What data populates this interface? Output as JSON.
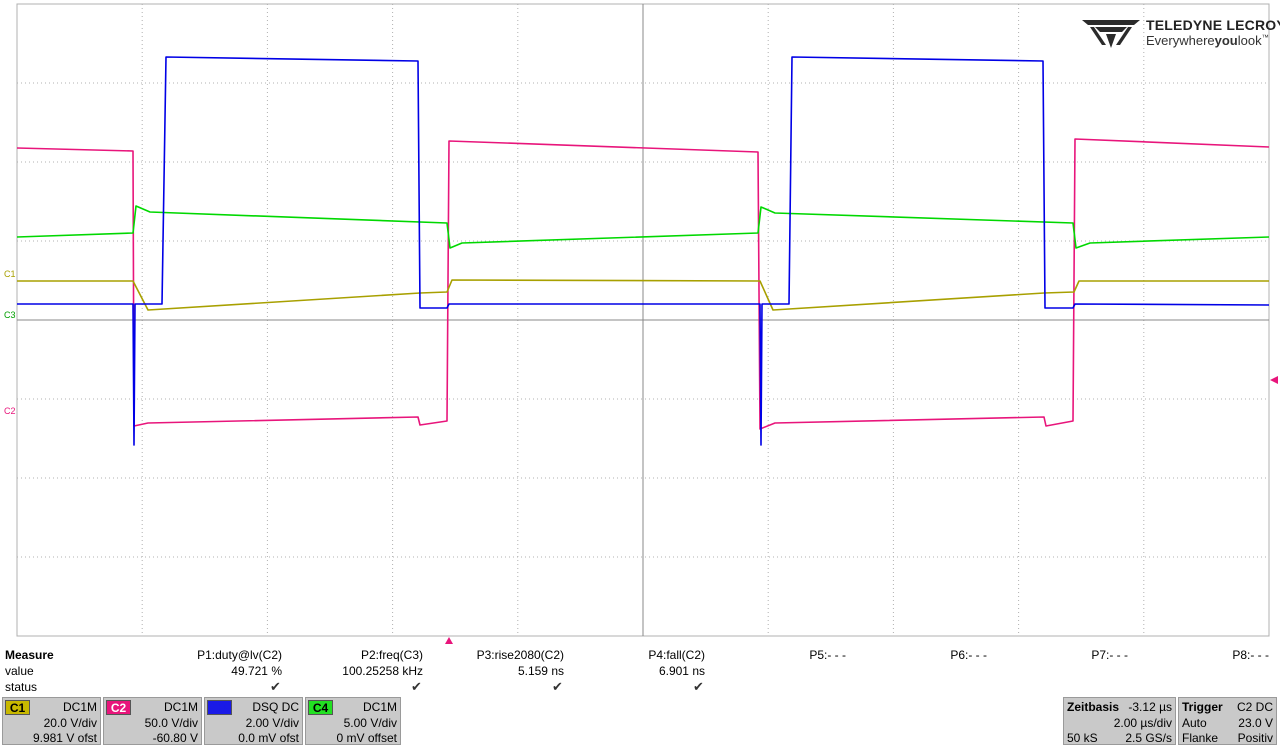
{
  "logo": {
    "brand": "TELEDYNE LECROY",
    "tag_pre": "Everywhere",
    "tag_bold": "you",
    "tag_post": "look",
    "tm": "™"
  },
  "channel_labels": {
    "c1": "C1",
    "c3": "C3",
    "c2": "C2"
  },
  "colors": {
    "c1": "#a8a000",
    "c2": "#e8157b",
    "c3": "#0000e6",
    "c4": "#00d800",
    "grid": "#b0b0b0"
  },
  "measure": {
    "row_labels": {
      "title": "Measure",
      "value": "value",
      "status": "status"
    },
    "params": [
      {
        "name": "P1:duty@lv(C2)",
        "value": "49.721 %",
        "ok": true
      },
      {
        "name": "P2:freq(C3)",
        "value": "100.25258 kHz",
        "ok": true
      },
      {
        "name": "P3:rise2080(C2)",
        "value": "5.159 ns",
        "ok": true
      },
      {
        "name": "P4:fall(C2)",
        "value": "6.901 ns",
        "ok": true
      },
      {
        "name": "P5:- - -",
        "value": "",
        "ok": false
      },
      {
        "name": "P6:- - -",
        "value": "",
        "ok": false
      },
      {
        "name": "P7:- - -",
        "value": "",
        "ok": false
      },
      {
        "name": "P8:- - -",
        "value": "",
        "ok": false
      }
    ],
    "check_glyph": "✔"
  },
  "channels": [
    {
      "badge": "C1",
      "coupling": "DC1M",
      "vdiv": "20.0 V/div",
      "offset": "9.981 V ofst"
    },
    {
      "badge": "C2",
      "coupling": "DC1M",
      "vdiv": "50.0 V/div",
      "offset": "-60.80 V"
    },
    {
      "badge": "C3",
      "coupling": "DSQ  DC",
      "vdiv": "2.00 V/div",
      "offset": "0.0 mV ofst"
    },
    {
      "badge": "C4",
      "coupling": "DC1M",
      "vdiv": "5.00 V/div",
      "offset": "0 mV offset"
    }
  ],
  "timebase": {
    "title": "Zeitbasis",
    "delay": "-3.12 µs",
    "tdiv": "2.00 µs/div",
    "samples": "50 kS",
    "rate": "2.5 GS/s"
  },
  "trigger": {
    "title": "Trigger",
    "source": "C2  DC",
    "mode": "Auto",
    "level": "23.0 V",
    "type": "Flanke",
    "slope": "Positiv"
  },
  "icons": {
    "trigger_position": "trigger-position-marker-icon",
    "trigger_level": "trigger-level-marker-icon"
  }
}
